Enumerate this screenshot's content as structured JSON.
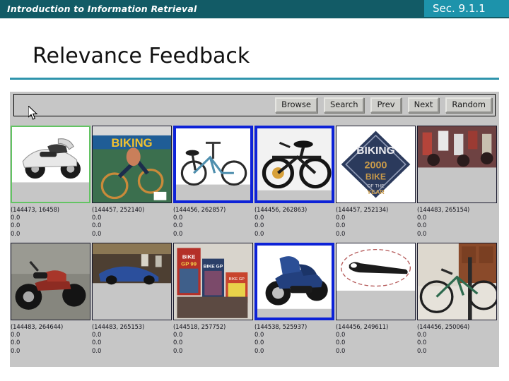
{
  "slide": {
    "header_title": "Introduction to Information Retrieval",
    "section_label": "Sec. 9.1.1",
    "title": "Relevance Feedback",
    "accent_color": "#125b66",
    "section_color": "#1d93ab",
    "underline_color": "#2e94ac"
  },
  "app": {
    "toolbar": {
      "buttons": [
        {
          "label": "Browse"
        },
        {
          "label": "Search"
        },
        {
          "label": "Prev"
        },
        {
          "label": "Next"
        },
        {
          "label": "Random"
        }
      ]
    },
    "selection_colors": {
      "relevant_green": "#63c463",
      "selected_blue": "#0d22d7",
      "plain_border": "#1a1a2e",
      "panel_background": "#c6c6c6"
    },
    "results": [
      {
        "id": "(144473, 16458)",
        "scores": [
          "0.0",
          "0.0",
          "0.0"
        ],
        "border": "sel-green",
        "image": "white-motor-scooter"
      },
      {
        "id": "(144457, 252140)",
        "scores": [
          "0.0",
          "0.0",
          "0.0"
        ],
        "border": "sel-plain",
        "image": "biking-magazine-cover"
      },
      {
        "id": "(144456, 262857)",
        "scores": [
          "0.0",
          "0.0",
          "0.0"
        ],
        "border": "sel-blue",
        "image": "white-folding-bicycle"
      },
      {
        "id": "(144456, 262863)",
        "scores": [
          "0.0",
          "0.0",
          "0.0"
        ],
        "border": "sel-blue",
        "image": "black-folding-bicycle"
      },
      {
        "id": "(144457, 252134)",
        "scores": [
          "0.0",
          "0.0",
          "0.0"
        ],
        "border": "sel-plain",
        "image": "biking-2000-bike-of-the-year-award"
      },
      {
        "id": "(144483, 265154)",
        "scores": [
          "0.0",
          "0.0",
          "0.0"
        ],
        "border": "sel-plain",
        "image": "crowded-bike-rack"
      },
      {
        "id": "(144483, 264644)",
        "scores": [
          "0.0",
          "0.0",
          "0.0"
        ],
        "border": "sel-plain",
        "image": "red-classic-motorcycle"
      },
      {
        "id": "(144483, 265153)",
        "scores": [
          "0.0",
          "0.0",
          "0.0"
        ],
        "border": "sel-plain",
        "image": "blue-scooter-in-crowd"
      },
      {
        "id": "(144518, 257752)",
        "scores": [
          "0.0",
          "0.0",
          "0.0"
        ],
        "border": "sel-plain",
        "image": "bike-gp-magazines"
      },
      {
        "id": "(144538, 525937)",
        "scores": [
          "0.0",
          "0.0",
          "0.0"
        ],
        "border": "sel-blue",
        "image": "blue-touring-motorcycle"
      },
      {
        "id": "(144456, 249611)",
        "scores": [
          "0.0",
          "0.0",
          "0.0"
        ],
        "border": "sel-plain",
        "image": "black-bike-lock-strap"
      },
      {
        "id": "(144456, 250064)",
        "scores": [
          "0.0",
          "0.0",
          "0.0"
        ],
        "border": "sel-plain",
        "image": "bicycles-on-wall-rack"
      }
    ]
  },
  "cursor": {
    "name": "mouse-pointer"
  }
}
